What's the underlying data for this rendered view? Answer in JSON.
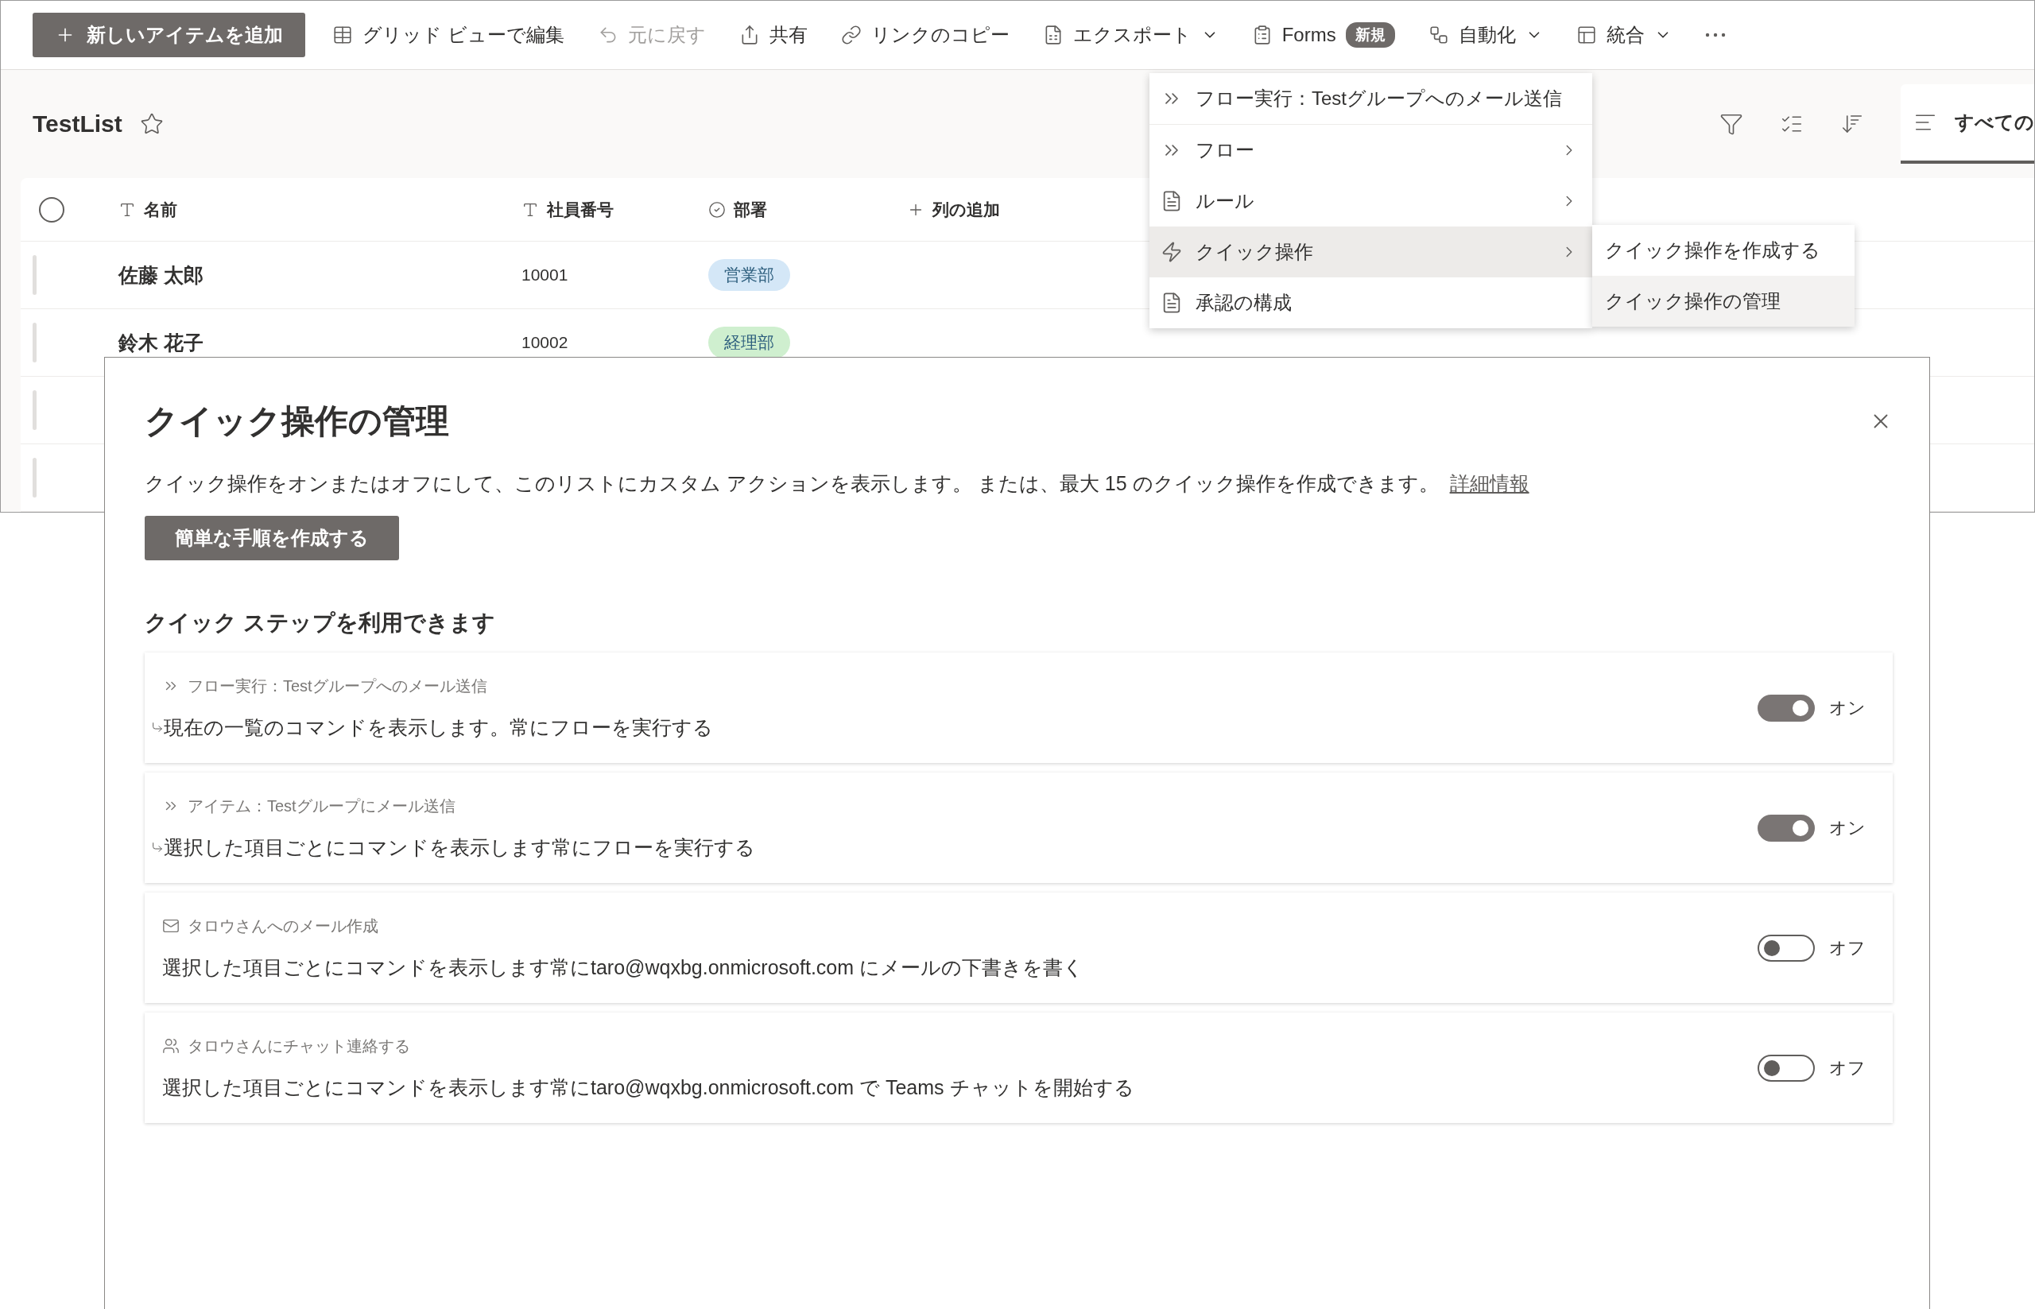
{
  "toolbar": {
    "items": [
      {
        "kind": "primary",
        "label": "新しいアイテムを追加",
        "dropdown": false,
        "disabled": false
      },
      {
        "kind": "command",
        "label": "グリッド ビューで編集",
        "dropdown": false,
        "disabled": false
      },
      {
        "kind": "command",
        "label": "元に戻す",
        "dropdown": false,
        "disabled": true
      },
      {
        "kind": "command",
        "label": "共有",
        "dropdown": false,
        "disabled": false
      },
      {
        "kind": "command",
        "label": "リンクのコピー",
        "dropdown": false,
        "disabled": false
      },
      {
        "kind": "command",
        "label": "エクスポート",
        "dropdown": true,
        "disabled": false
      },
      {
        "kind": "command",
        "label": "Forms",
        "badge": "新規",
        "dropdown": false,
        "disabled": false
      },
      {
        "kind": "command",
        "label": "自動化",
        "dropdown": true,
        "disabled": false
      },
      {
        "kind": "command",
        "label": "統合",
        "dropdown": true,
        "disabled": false
      },
      {
        "kind": "more"
      }
    ]
  },
  "list": {
    "title": "TestList",
    "favorite": false,
    "view_tab": {
      "label": "すべての",
      "selected": true
    },
    "columns": [
      {
        "kind": "text",
        "label": "名前"
      },
      {
        "kind": "text",
        "label": "社員番号"
      },
      {
        "kind": "choice",
        "label": "部署"
      },
      {
        "kind": "add",
        "label": "列の追加"
      }
    ],
    "rows": [
      {
        "name": "佐藤 太郎",
        "employee_id": "10001",
        "department": {
          "label": "営業部",
          "color": "#d4e7f7"
        }
      },
      {
        "name": "鈴木 花子",
        "employee_id": "10002",
        "department": {
          "label": "経理部",
          "color": "#cfefcf"
        }
      }
    ]
  },
  "menu": {
    "items": [
      {
        "kind": "flow",
        "label": "フロー実行：Testグループへのメール送信",
        "submenu": false,
        "selected": false
      },
      {
        "kind": "flow",
        "label": "フロー",
        "submenu": true,
        "selected": false
      },
      {
        "kind": "rule",
        "label": "ルール",
        "submenu": true,
        "selected": false
      },
      {
        "kind": "quick",
        "label": "クイック操作",
        "submenu": true,
        "selected": true
      },
      {
        "kind": "rule",
        "label": "承認の構成",
        "submenu": false,
        "selected": false
      }
    ],
    "submenu": [
      {
        "label": "クイック操作を作成する",
        "selected": false
      },
      {
        "label": "クイック操作の管理",
        "selected": true
      }
    ]
  },
  "dialog": {
    "title": "クイック操作の管理",
    "description": "クイック操作をオンまたはオフにして、このリストにカスタム アクションを表示します。 または、最大 15 のクイック操作を作成できます。",
    "link": "詳細情報",
    "create_button": "簡単な手順を作成する",
    "section_title": "クイック ステップを利用できます",
    "steps": [
      {
        "kind": "flow",
        "title": "フロー実行：Testグループへのメール送信",
        "description": "現在の一覧のコマンドを表示します。常にフローを実行する",
        "on": true,
        "state_label": "オン",
        "cursor": true
      },
      {
        "kind": "flow",
        "title": "アイテム：Testグループにメール送信",
        "description": "選択した項目ごとにコマンドを表示します常にフローを実行する",
        "on": true,
        "state_label": "オン",
        "cursor": true
      },
      {
        "kind": "mail",
        "title": "タロウさんへのメール作成",
        "description": "選択した項目ごとにコマンドを表示します常にtaro@wqxbg.onmicrosoft.com にメールの下書きを書く",
        "on": false,
        "state_label": "オフ",
        "cursor": false
      },
      {
        "kind": "chat",
        "title": "タロウさんにチャット連絡する",
        "description": "選択した項目ごとにコマンドを表示します常にtaro@wqxbg.onmicrosoft.com で Teams チャットを開始する",
        "on": false,
        "state_label": "オフ",
        "cursor": false
      }
    ]
  }
}
